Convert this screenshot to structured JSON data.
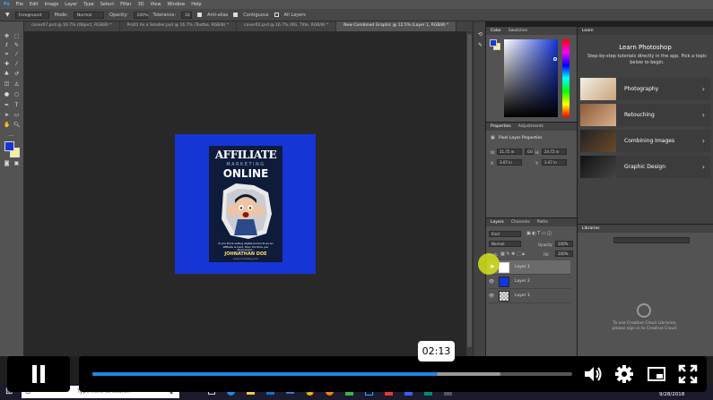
{
  "menu": [
    "Ps",
    "File",
    "Edit",
    "Image",
    "Layer",
    "Type",
    "Select",
    "Filter",
    "3D",
    "View",
    "Window",
    "Help"
  ],
  "options": {
    "tool_preset": "Foreground",
    "mode_label": "Mode:",
    "mode_value": "Normal",
    "opacity_label": "Opacity:",
    "opacity_value": "100%",
    "tolerance_label": "Tolerance:",
    "tolerance_value": "32",
    "antialias": "Anti-alias",
    "contiguous": "Contiguous",
    "all_layers": "All Layers"
  },
  "doc_tabs": [
    "cover07.psd @ 16.7% (Object, RGB/8) *",
    "Pro01 As a Smaller.psd @ 16.7% (Textbe, RGB/8) *",
    "cover02.psd @ 16.7% (RG, Title, RGB/8) *",
    "New Combined Graphic @ 12.5% (Layer 1, RGB/8) *"
  ],
  "book": {
    "title": "AFFILIATE",
    "subtitle": "MARKETING",
    "subtitle2": "ONLINE",
    "blurb": "If you think selling digital products as an affiliate is hard, then it's time you discovered...",
    "author": "JOHNATHAN DOE",
    "tagline": "online.marketing.com"
  },
  "color_panel": {
    "tabs": [
      "Color",
      "Swatches"
    ]
  },
  "properties_panel": {
    "tabs": [
      "Properties",
      "Adjustments"
    ],
    "heading": "Pixel Layer Properties",
    "w_label": "W:",
    "w_value": "11.75 in",
    "h_label": "H:",
    "h_value": "24.72 in",
    "x_label": "X:",
    "x_value": "3.07 in",
    "y_label": "Y:",
    "y_value": "3.47 in",
    "go_label": "GO"
  },
  "layers_panel": {
    "tabs": [
      "Layers",
      "Channels",
      "Paths"
    ],
    "kind": "Kind",
    "blend": "Normal",
    "opacity_label": "Opacity:",
    "opacity_value": "100%",
    "lock_label": "Lock:",
    "fill_label": "Fill:",
    "fill_value": "100%",
    "layers": [
      "Layer 1",
      "Layer 2",
      "Layer 1"
    ]
  },
  "learn_panel": {
    "tab": "Learn",
    "title": "Learn Photoshop",
    "description": "Step-by-step tutorials directly in the app. Pick a topic below to begin.",
    "items": [
      "Photography",
      "Retouching",
      "Combining Images",
      "Graphic Design"
    ]
  },
  "libraries_panel": {
    "tab": "Libraries",
    "message": "To use Creative Cloud Libraries, please sign in to Creative Cloud."
  },
  "video": {
    "time": "02:13",
    "progress": 0.72,
    "buffered": 0.85
  },
  "taskbar": {
    "search_placeholder": "Type here to search",
    "date": "9/28/2018"
  },
  "colors": {
    "canvas_blue": "#1635d6",
    "progress_blue": "#1e88e5",
    "cursor_highlight": "#d4e21a"
  }
}
